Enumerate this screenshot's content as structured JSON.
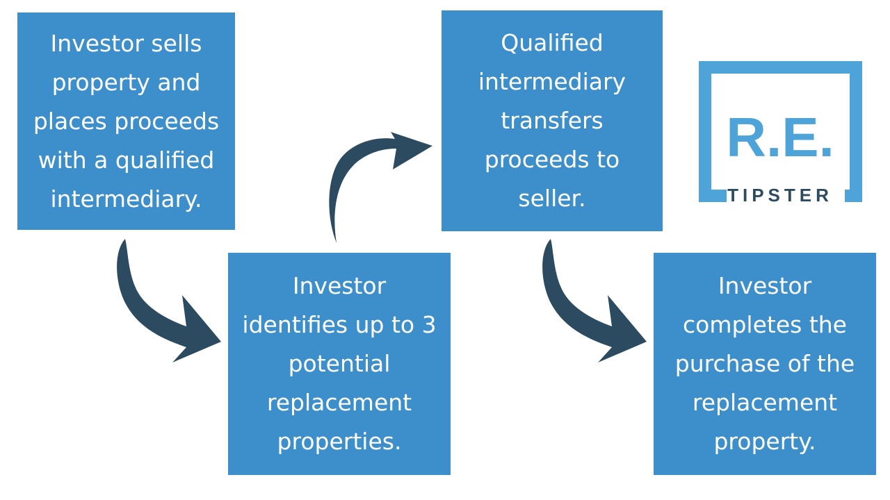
{
  "steps": [
    {
      "text": "Investor sells property and places proceeds with a qualified intermediary."
    },
    {
      "text": "Investor identifies up to 3 potential replacement properties."
    },
    {
      "text": "Qualified intermediary transfers proceeds to seller."
    },
    {
      "text": "Investor completes the purchase of the replacement property."
    }
  ],
  "logo": {
    "mark": "R.E.",
    "word": "TIPSTER"
  },
  "colors": {
    "box": "#3d8fcb",
    "arrow": "#2c4a60",
    "logo_blue": "#4ea3d8",
    "logo_dark": "#2c4a60"
  }
}
